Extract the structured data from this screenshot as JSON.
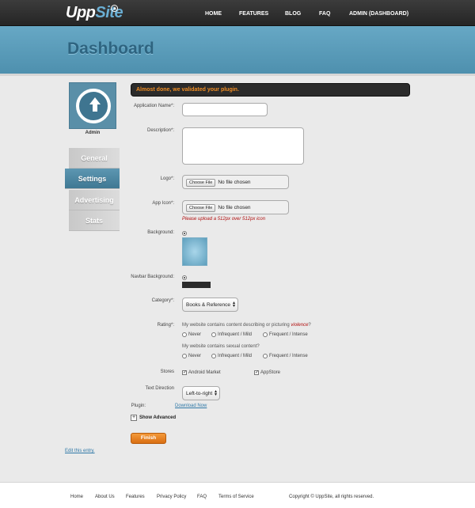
{
  "brand": {
    "name_part1": "Upp",
    "name_part2": "Site",
    "logo_icon": "arrow-up-circle-icon"
  },
  "nav": {
    "home": "HOME",
    "features": "FEATURES",
    "blog": "BLOG",
    "faq": "FAQ",
    "admin": "ADMIN (DASHBOARD)"
  },
  "header": {
    "title": "Dashboard"
  },
  "sidebar": {
    "avatar_icon": "arrow-up-circle-icon",
    "user_label": "Admin",
    "tabs": [
      {
        "label": "General",
        "active": false
      },
      {
        "label": "Settings",
        "active": true
      },
      {
        "label": "Advertising",
        "active": false
      },
      {
        "label": "Stats",
        "active": false
      }
    ]
  },
  "alert": {
    "message": "Almost done, we validated your plugin."
  },
  "form": {
    "app_name": {
      "label": "Application Name*:",
      "value": ""
    },
    "description": {
      "label": "Description*:",
      "value": ""
    },
    "logo": {
      "label": "Logo*:",
      "button": "Choose File",
      "status": "No file chosen"
    },
    "app_icon": {
      "label": "App Icon*:",
      "button": "Choose File",
      "status": "No file chosen",
      "error": "Please upload a 512px over 512px icon"
    },
    "background": {
      "label": "Background:",
      "color": "#6aaed3"
    },
    "navbar_background": {
      "label": "Navbar Background:",
      "color": "#2b2b2b"
    },
    "category": {
      "label": "Category*:",
      "value": "Books & Reference"
    },
    "rating": {
      "label": "Rating*:",
      "q1_prefix": "My website contains content describing or picturing ",
      "q1_highlight": "violence",
      "q1_suffix": "?",
      "q2": "My website contains sexual content?",
      "options": [
        "Never",
        "Infrequent / Mild",
        "Frequent / Intense"
      ]
    },
    "stores": {
      "label": "Stores",
      "android": "Android Market",
      "appstore": "AppStore",
      "android_checked": true,
      "appstore_checked": true
    },
    "text_direction": {
      "label": "Text Direction",
      "value": "Left-to-right"
    },
    "plugin": {
      "label": "Plugin:",
      "link": "Download Now"
    },
    "show_advanced": "Show Advanced",
    "finish": "Finish"
  },
  "edit_link": "Edit this entry.",
  "footer": {
    "links": [
      "Home",
      "About Us",
      "Features",
      "Privacy Policy",
      "FAQ",
      "Terms of Service"
    ],
    "copyright": "Copyright © UppSite, all rights reserved."
  },
  "colors": {
    "accent": "#4e90ae",
    "alert_text": "#f08d23",
    "error": "#b10e0e",
    "button": "#e07d1f"
  }
}
